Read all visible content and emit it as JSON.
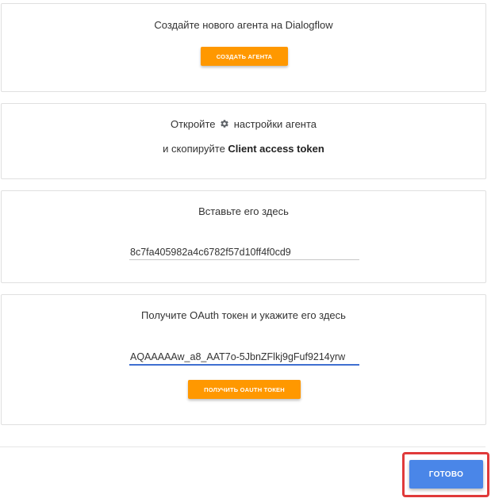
{
  "step1": {
    "text": "Создайте нового агента на Dialogflow",
    "button_label": "СОЗДАТЬ АГЕНТА"
  },
  "step2": {
    "text_before": "Откройте",
    "text_after": "настройки агента",
    "line2_before": "и скопируйте",
    "line2_bold": "Client access token",
    "icon": "gear-icon"
  },
  "step3": {
    "text": "Вставьте его здесь",
    "token_value": "8c7fa405982a4c6782f57d10ff4f0cd9"
  },
  "step4": {
    "text": "Получите OAuth токен и укажите его здесь",
    "oauth_value": "AQAAAAAw_a8_AAT7o-5JbnZFlkj9gFuf9214yrw",
    "button_label": "ПОЛУЧИТЬ OAUTH ТОКЕН"
  },
  "footer": {
    "done_label": "ГОТОВО"
  },
  "colors": {
    "orange": "#ff9800",
    "blue": "#4a86e8",
    "highlight": "#e03a3a",
    "focus_underline": "#3f6fd1"
  }
}
